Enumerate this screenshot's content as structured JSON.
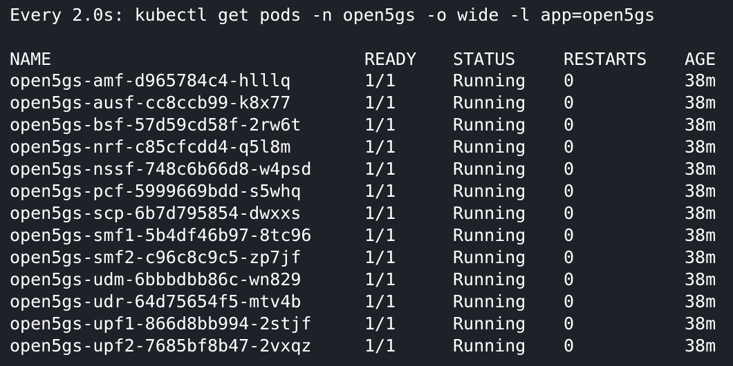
{
  "command": "Every 2.0s: kubectl get pods -n open5gs -o wide -l app=open5gs",
  "headers": {
    "name": "NAME",
    "ready": "READY",
    "status": "STATUS",
    "restarts": "RESTARTS",
    "age": "AGE"
  },
  "pods": [
    {
      "name": "open5gs-amf-d965784c4-hlllq",
      "ready": "1/1",
      "status": "Running",
      "restarts": "0",
      "age": "38m"
    },
    {
      "name": "open5gs-ausf-cc8ccb99-k8x77",
      "ready": "1/1",
      "status": "Running",
      "restarts": "0",
      "age": "38m"
    },
    {
      "name": "open5gs-bsf-57d59cd58f-2rw6t",
      "ready": "1/1",
      "status": "Running",
      "restarts": "0",
      "age": "38m"
    },
    {
      "name": "open5gs-nrf-c85cfcdd4-q5l8m",
      "ready": "1/1",
      "status": "Running",
      "restarts": "0",
      "age": "38m"
    },
    {
      "name": "open5gs-nssf-748c6b66d8-w4psd",
      "ready": "1/1",
      "status": "Running",
      "restarts": "0",
      "age": "38m"
    },
    {
      "name": "open5gs-pcf-5999669bdd-s5whq",
      "ready": "1/1",
      "status": "Running",
      "restarts": "0",
      "age": "38m"
    },
    {
      "name": "open5gs-scp-6b7d795854-dwxxs",
      "ready": "1/1",
      "status": "Running",
      "restarts": "0",
      "age": "38m"
    },
    {
      "name": "open5gs-smf1-5b4df46b97-8tc96",
      "ready": "1/1",
      "status": "Running",
      "restarts": "0",
      "age": "38m"
    },
    {
      "name": "open5gs-smf2-c96c8c9c5-zp7jf",
      "ready": "1/1",
      "status": "Running",
      "restarts": "0",
      "age": "38m"
    },
    {
      "name": "open5gs-udm-6bbbdbb86c-wn829",
      "ready": "1/1",
      "status": "Running",
      "restarts": "0",
      "age": "38m"
    },
    {
      "name": "open5gs-udr-64d75654f5-mtv4b",
      "ready": "1/1",
      "status": "Running",
      "restarts": "0",
      "age": "38m"
    },
    {
      "name": "open5gs-upf1-866d8bb994-2stjf",
      "ready": "1/1",
      "status": "Running",
      "restarts": "0",
      "age": "38m"
    },
    {
      "name": "open5gs-upf2-7685bf8b47-2vxqz",
      "ready": "1/1",
      "status": "Running",
      "restarts": "0",
      "age": "38m"
    }
  ]
}
